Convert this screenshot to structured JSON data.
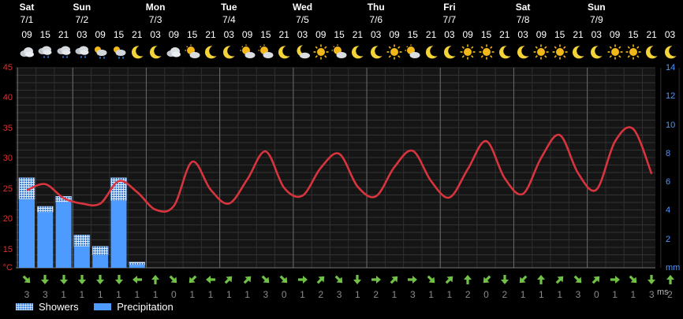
{
  "days": [
    {
      "name": "Sat",
      "date": "7/1",
      "at": 0
    },
    {
      "name": "Sun",
      "date": "7/2",
      "at": 3
    },
    {
      "name": "Mon",
      "date": "7/3",
      "at": 7
    },
    {
      "name": "Tue",
      "date": "7/4",
      "at": 11
    },
    {
      "name": "Wed",
      "date": "7/5",
      "at": 15
    },
    {
      "name": "Thu",
      "date": "7/6",
      "at": 19
    },
    {
      "name": "Fri",
      "date": "7/7",
      "at": 23
    },
    {
      "name": "Sat",
      "date": "7/8",
      "at": 27
    },
    {
      "name": "Sun",
      "date": "7/9",
      "at": 31
    }
  ],
  "slots": [
    {
      "hour": "09",
      "icon": "cloudy-icon",
      "wdir": "se",
      "wspd": "3"
    },
    {
      "hour": "15",
      "icon": "rain-cloud-icon",
      "wdir": "s",
      "wspd": "3"
    },
    {
      "hour": "21",
      "icon": "rain-cloud-icon",
      "wdir": "s",
      "wspd": "1"
    },
    {
      "hour": "03",
      "icon": "rain-cloud-icon",
      "wdir": "s",
      "wspd": "1"
    },
    {
      "hour": "09",
      "icon": "sun-shower-icon",
      "wdir": "s",
      "wspd": "1"
    },
    {
      "hour": "15",
      "icon": "sun-shower-icon",
      "wdir": "s",
      "wspd": "1"
    },
    {
      "hour": "21",
      "icon": "moon-icon",
      "wdir": "w",
      "wspd": "1"
    },
    {
      "hour": "03",
      "icon": "moon-icon",
      "wdir": "n",
      "wspd": "1"
    },
    {
      "hour": "09",
      "icon": "cloudy-icon",
      "wdir": "se",
      "wspd": "0"
    },
    {
      "hour": "15",
      "icon": "partly-cloudy-icon",
      "wdir": "sw",
      "wspd": "1"
    },
    {
      "hour": "21",
      "icon": "moon-icon",
      "wdir": "w",
      "wspd": "1"
    },
    {
      "hour": "03",
      "icon": "moon-icon",
      "wdir": "ne",
      "wspd": "1"
    },
    {
      "hour": "09",
      "icon": "partly-cloudy-icon",
      "wdir": "ne",
      "wspd": "1"
    },
    {
      "hour": "15",
      "icon": "partly-cloudy-icon",
      "wdir": "se",
      "wspd": "3"
    },
    {
      "hour": "21",
      "icon": "moon-icon",
      "wdir": "se",
      "wspd": "0"
    },
    {
      "hour": "03",
      "icon": "moon-cloud-icon",
      "wdir": "e",
      "wspd": "1"
    },
    {
      "hour": "09",
      "icon": "sun-icon",
      "wdir": "ne",
      "wspd": "2"
    },
    {
      "hour": "15",
      "icon": "partly-cloudy-icon",
      "wdir": "se",
      "wspd": "3"
    },
    {
      "hour": "21",
      "icon": "moon-icon",
      "wdir": "s",
      "wspd": "1"
    },
    {
      "hour": "03",
      "icon": "moon-icon",
      "wdir": "e",
      "wspd": "2"
    },
    {
      "hour": "09",
      "icon": "sun-icon",
      "wdir": "ne",
      "wspd": "1"
    },
    {
      "hour": "15",
      "icon": "partly-cloudy-icon",
      "wdir": "e",
      "wspd": "3"
    },
    {
      "hour": "21",
      "icon": "moon-icon",
      "wdir": "se",
      "wspd": "1"
    },
    {
      "hour": "03",
      "icon": "moon-icon",
      "wdir": "ne",
      "wspd": "1"
    },
    {
      "hour": "09",
      "icon": "sun-icon",
      "wdir": "n",
      "wspd": "2"
    },
    {
      "hour": "15",
      "icon": "sun-icon",
      "wdir": "sw",
      "wspd": "0"
    },
    {
      "hour": "21",
      "icon": "moon-icon",
      "wdir": "s",
      "wspd": "2"
    },
    {
      "hour": "03",
      "icon": "moon-icon",
      "wdir": "sw",
      "wspd": "1"
    },
    {
      "hour": "09",
      "icon": "sun-icon",
      "wdir": "n",
      "wspd": "1"
    },
    {
      "hour": "15",
      "icon": "sun-icon",
      "wdir": "ne",
      "wspd": "1"
    },
    {
      "hour": "21",
      "icon": "moon-icon",
      "wdir": "se",
      "wspd": "3"
    },
    {
      "hour": "03",
      "icon": "moon-icon",
      "wdir": "ne",
      "wspd": "0"
    },
    {
      "hour": "09",
      "icon": "sun-icon",
      "wdir": "e",
      "wspd": "1"
    },
    {
      "hour": "15",
      "icon": "sun-icon",
      "wdir": "se",
      "wspd": "1"
    },
    {
      "hour": "21",
      "icon": "moon-icon",
      "wdir": "s",
      "wspd": "3"
    },
    {
      "hour": "03",
      "icon": "moon-icon",
      "wdir": "n",
      "wspd": "2"
    }
  ],
  "legend": {
    "showers": "Showers",
    "precipitation": "Precipitation",
    "wind_unit": "ms"
  },
  "colors": {
    "temp_line": "#d8343e",
    "precip": "#4d9bff",
    "showers": "#4a8fe8",
    "temp_axis": "#e03030",
    "precip_axis": "#4f97ff",
    "wind_arrow": "#6fc245"
  },
  "chart_data": {
    "type": "line",
    "x": [
      0,
      1,
      2,
      3,
      4,
      5,
      6,
      7,
      8,
      9,
      10,
      11,
      12,
      13,
      14,
      15,
      16,
      17,
      18,
      19,
      20,
      21,
      22,
      23,
      24,
      25,
      26,
      27,
      28,
      29,
      30,
      31,
      32,
      33,
      34,
      35
    ],
    "series": [
      {
        "values": [
          24.8,
          25.8,
          23.5,
          22.6,
          22.6,
          26.3,
          24.5,
          21.6,
          22.2,
          29.5,
          24.9,
          22.6,
          26.6,
          31.2,
          25.2,
          23.9,
          28.5,
          30.8,
          25.4,
          23.8,
          28.6,
          31.3,
          26.3,
          23.6,
          28.3,
          32.9,
          26.8,
          24.2,
          30.2,
          33.9,
          27.6,
          24.9,
          32.8,
          34.9,
          27.5
        ]
      },
      {
        "values": [
          4.8,
          3.9,
          4.6,
          1.5,
          0.9,
          4.7,
          0.2,
          0,
          0,
          0,
          0,
          0,
          0,
          0,
          0,
          0,
          0,
          0,
          0,
          0,
          0,
          0,
          0,
          0,
          0,
          0,
          0,
          0,
          0,
          0,
          0,
          0,
          0,
          0,
          0,
          0
        ]
      },
      {
        "values": [
          6.3,
          4.3,
          5.0,
          2.3,
          1.5,
          6.3,
          0.4,
          0,
          0,
          0,
          0,
          0,
          0,
          0,
          0,
          0,
          0,
          0,
          0,
          0,
          0,
          0,
          0,
          0,
          0,
          0,
          0,
          0,
          0,
          0,
          0,
          0,
          0,
          0,
          0,
          0
        ]
      }
    ],
    "yticks": [
      "45",
      "40",
      "35",
      "30",
      "25",
      "20",
      "15",
      "°C"
    ],
    "y2ticks": [
      "14",
      "12",
      "10",
      "8",
      "6",
      "4",
      "2",
      "mm"
    ],
    "ylim": [
      12,
      45
    ],
    "y2lim": [
      0,
      14
    ],
    "grid": true
  }
}
